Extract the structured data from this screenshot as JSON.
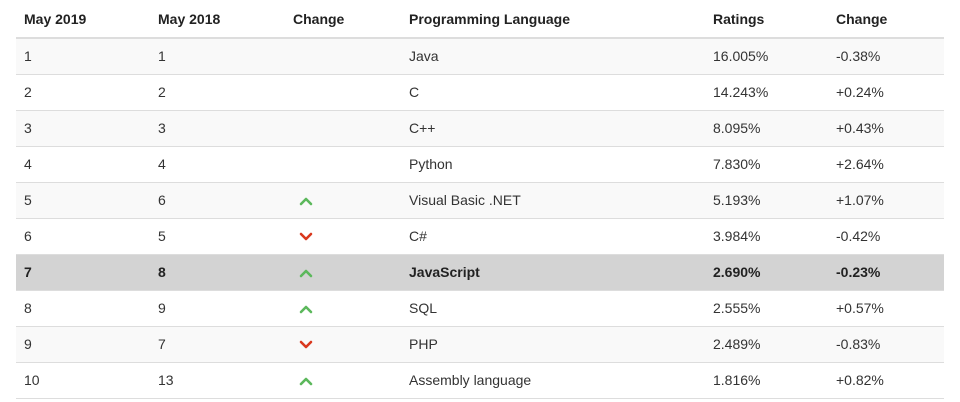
{
  "table": {
    "headers": [
      "May 2019",
      "May 2018",
      "Change",
      "Programming Language",
      "Ratings",
      "Change"
    ],
    "rows": [
      {
        "rank_2019": "1",
        "rank_2018": "1",
        "trend": "none",
        "language": "Java",
        "rating": "16.005%",
        "change": "-0.38%"
      },
      {
        "rank_2019": "2",
        "rank_2018": "2",
        "trend": "none",
        "language": "C",
        "rating": "14.243%",
        "change": "+0.24%"
      },
      {
        "rank_2019": "3",
        "rank_2018": "3",
        "trend": "none",
        "language": "C++",
        "rating": "8.095%",
        "change": "+0.43%"
      },
      {
        "rank_2019": "4",
        "rank_2018": "4",
        "trend": "none",
        "language": "Python",
        "rating": "7.830%",
        "change": "+2.64%"
      },
      {
        "rank_2019": "5",
        "rank_2018": "6",
        "trend": "up",
        "language": "Visual Basic .NET",
        "rating": "5.193%",
        "change": "+1.07%"
      },
      {
        "rank_2019": "6",
        "rank_2018": "5",
        "trend": "down",
        "language": "C#",
        "rating": "3.984%",
        "change": "-0.42%"
      },
      {
        "rank_2019": "7",
        "rank_2018": "8",
        "trend": "up",
        "language": "JavaScript",
        "rating": "2.690%",
        "change": "-0.23%",
        "highlighted": true
      },
      {
        "rank_2019": "8",
        "rank_2018": "9",
        "trend": "up",
        "language": "SQL",
        "rating": "2.555%",
        "change": "+0.57%"
      },
      {
        "rank_2019": "9",
        "rank_2018": "7",
        "trend": "down",
        "language": "PHP",
        "rating": "2.489%",
        "change": "-0.83%"
      },
      {
        "rank_2019": "10",
        "rank_2018": "13",
        "trend": "up",
        "language": "Assembly language",
        "rating": "1.816%",
        "change": "+0.82%"
      }
    ]
  },
  "icons": {
    "up": "chevron-up-icon",
    "down": "chevron-down-icon"
  },
  "colors": {
    "up": "#5cb85c",
    "down": "#d9381e",
    "highlight_row": "#d3d3d3"
  }
}
